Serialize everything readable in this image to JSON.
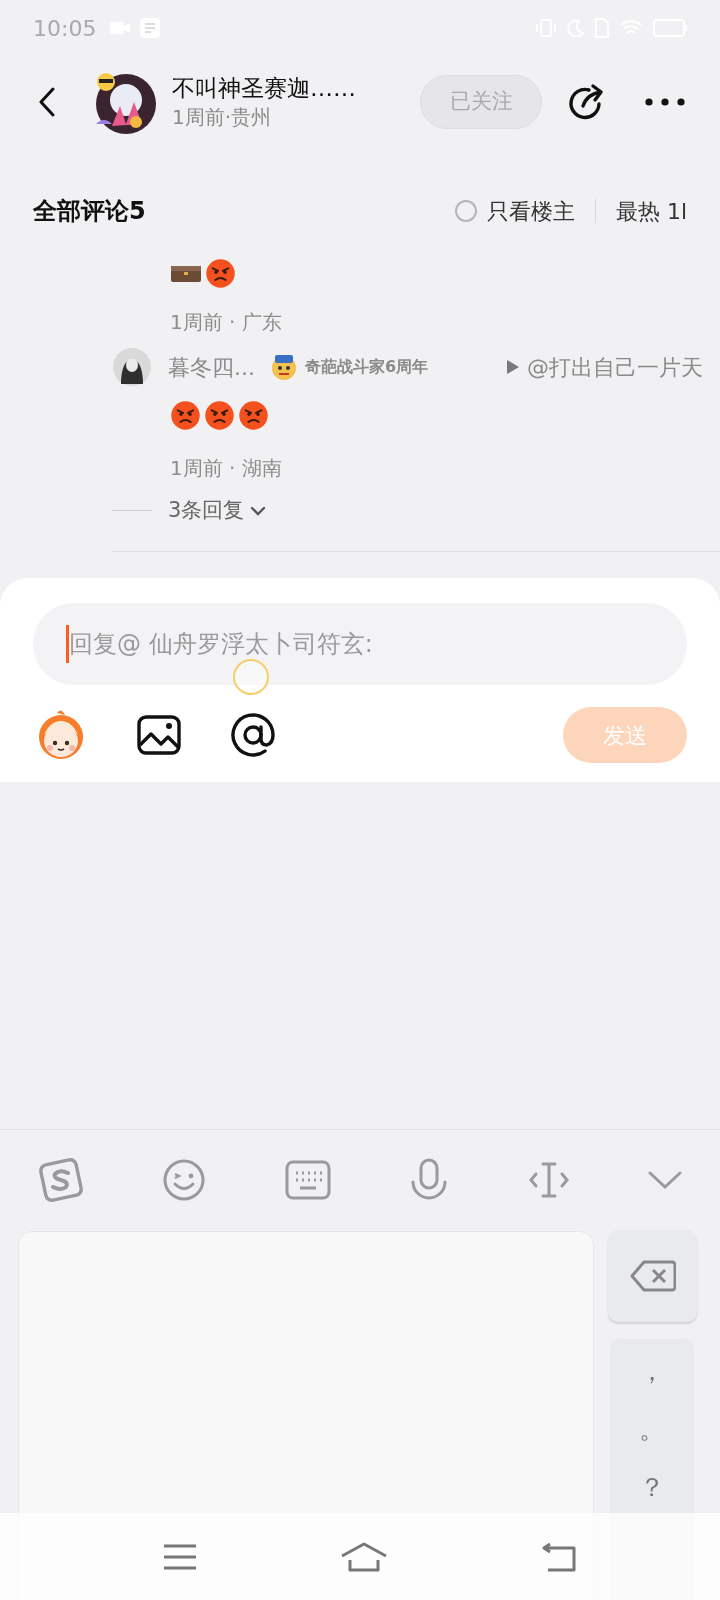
{
  "status_bar": {
    "time": "10:05"
  },
  "header": {
    "author": "不叫神圣赛迦……",
    "meta": "1周前·贵州",
    "follow": {
      "label": "已关注",
      "followed": true
    }
  },
  "comments_bar": {
    "title": "全部评论5",
    "owner_only": {
      "label": "只看楼主",
      "checked": false
    },
    "sort": "最热 1l"
  },
  "comment": {
    "content": [
      {
        "kind": "briefcase"
      },
      {
        "kind": "angry"
      }
    ],
    "meta": "1周前 · 广东"
  },
  "reply": {
    "author": "暮冬四...",
    "badge": "奇葩战斗家6周年",
    "target": "@打出自己一片天",
    "content": [
      {
        "kind": "angry"
      },
      {
        "kind": "angry"
      },
      {
        "kind": "angry"
      }
    ],
    "meta": "1周前 · 湖南"
  },
  "more_replies": "3条回复",
  "composer": {
    "placeholder": "回复@ 仙舟罗浮太卜司符玄:",
    "send": {
      "label": "发送",
      "disabled": true
    }
  },
  "keyboard": {
    "keys": [
      "，",
      "。",
      "？"
    ]
  }
}
